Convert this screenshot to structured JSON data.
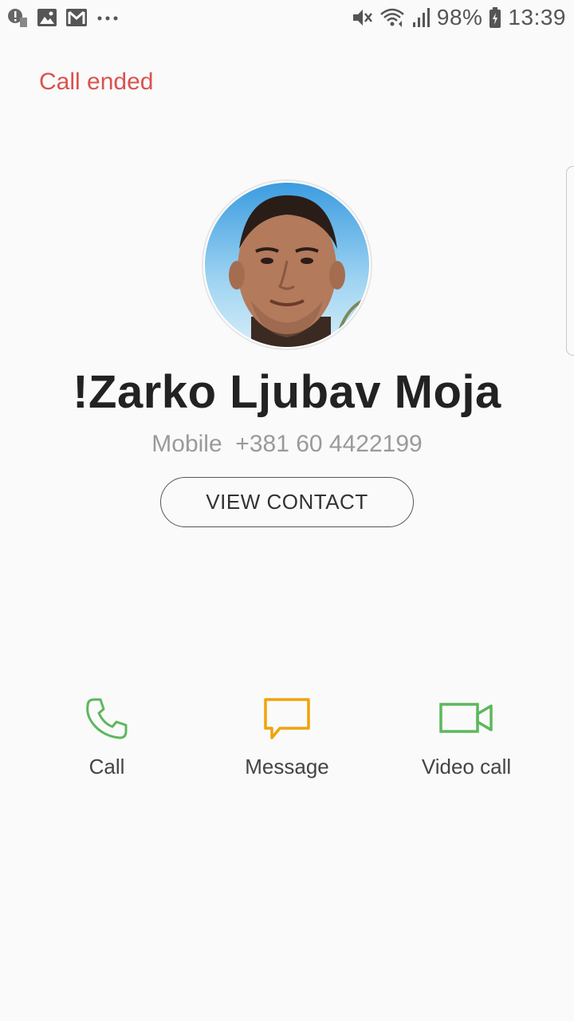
{
  "status_bar": {
    "left_icons": [
      "alert-icon",
      "image-icon",
      "gmail-icon",
      "more-icon"
    ],
    "right_icons": [
      "mute-icon",
      "wifi-icon",
      "signal-icon",
      "battery-icon"
    ],
    "battery_pct": "98%",
    "time": "13:39"
  },
  "call": {
    "status": "Call ended",
    "status_color": "#d9534f"
  },
  "contact": {
    "name": "!Zarko Ljubav Moja",
    "number_line": "Mobile  +381 60 4422199",
    "view_contact_label": "VIEW CONTACT"
  },
  "actions": [
    {
      "label": "Call",
      "icon": "phone-icon",
      "color": "#5cb85c"
    },
    {
      "label": "Message",
      "icon": "message-icon",
      "color": "#f0a30a"
    },
    {
      "label": "Video call",
      "icon": "video-icon",
      "color": "#5cb85c"
    }
  ]
}
